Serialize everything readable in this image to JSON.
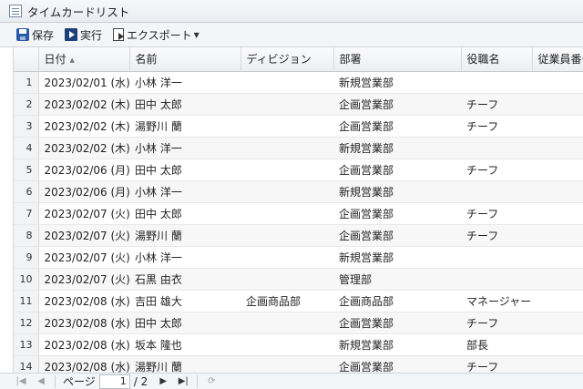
{
  "window": {
    "title": "タイムカードリスト"
  },
  "toolbar": {
    "save_label": "保存",
    "run_label": "実行",
    "export_label": "エクスポート"
  },
  "grid": {
    "columns": [
      "日付",
      "名前",
      "ディビジョン",
      "部署",
      "役職名",
      "従業員番号"
    ],
    "rows": [
      {
        "n": "1",
        "date": "2023/02/01 (水)",
        "name": "小林 洋一",
        "division": "",
        "dept": "新規営業部",
        "title": ""
      },
      {
        "n": "2",
        "date": "2023/02/02 (木)",
        "name": "田中 太郎",
        "division": "",
        "dept": "企画営業部",
        "title": "チーフ"
      },
      {
        "n": "3",
        "date": "2023/02/02 (木)",
        "name": "湯野川 蘭",
        "division": "",
        "dept": "企画営業部",
        "title": "チーフ"
      },
      {
        "n": "4",
        "date": "2023/02/02 (木)",
        "name": "小林 洋一",
        "division": "",
        "dept": "新規営業部",
        "title": ""
      },
      {
        "n": "5",
        "date": "2023/02/06 (月)",
        "name": "田中 太郎",
        "division": "",
        "dept": "企画営業部",
        "title": "チーフ"
      },
      {
        "n": "6",
        "date": "2023/02/06 (月)",
        "name": "小林 洋一",
        "division": "",
        "dept": "新規営業部",
        "title": ""
      },
      {
        "n": "7",
        "date": "2023/02/07 (火)",
        "name": "田中 太郎",
        "division": "",
        "dept": "企画営業部",
        "title": "チーフ"
      },
      {
        "n": "8",
        "date": "2023/02/07 (火)",
        "name": "湯野川 蘭",
        "division": "",
        "dept": "企画営業部",
        "title": "チーフ"
      },
      {
        "n": "9",
        "date": "2023/02/07 (火)",
        "name": "小林 洋一",
        "division": "",
        "dept": "新規営業部",
        "title": ""
      },
      {
        "n": "10",
        "date": "2023/02/07 (火)",
        "name": "石黒 由衣",
        "division": "",
        "dept": "管理部",
        "title": ""
      },
      {
        "n": "11",
        "date": "2023/02/08 (水)",
        "name": "吉田 雄大",
        "division": "企画商品部",
        "dept": "企画商品部",
        "title": "マネージャー"
      },
      {
        "n": "12",
        "date": "2023/02/08 (水)",
        "name": "田中 太郎",
        "division": "",
        "dept": "企画営業部",
        "title": "チーフ"
      },
      {
        "n": "13",
        "date": "2023/02/08 (水)",
        "name": "坂本 隆也",
        "division": "",
        "dept": "新規営業部",
        "title": "部長"
      },
      {
        "n": "14",
        "date": "2023/02/08 (水)",
        "name": "湯野川 蘭",
        "division": "",
        "dept": "企画営業部",
        "title": "チーフ"
      }
    ]
  },
  "pager": {
    "page_label": "ページ",
    "current_page": "1",
    "total": "/ 2"
  }
}
